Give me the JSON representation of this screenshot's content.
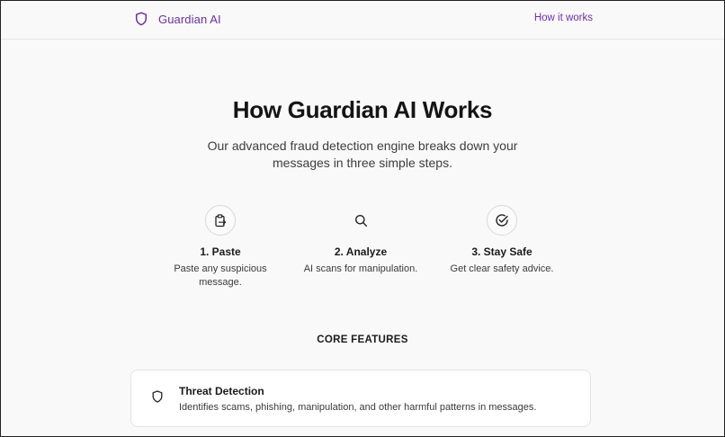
{
  "header": {
    "brand": "Guardian AI",
    "brand_icon": "shield-icon",
    "nav_link": "How it works",
    "accent_color": "#6b2fa6"
  },
  "hero": {
    "title": "How Guardian AI Works",
    "subtitle": "Our advanced fraud detection engine breaks down your messages in three simple steps."
  },
  "steps": [
    {
      "icon": "clipboard-icon",
      "title": "1. Paste",
      "description": "Paste any suspicious message."
    },
    {
      "icon": "search-icon",
      "title": "2. Analyze",
      "description": "AI scans for manipulation."
    },
    {
      "icon": "check-circle-icon",
      "title": "3. Stay Safe",
      "description": "Get clear safety advice."
    }
  ],
  "features": {
    "heading": "CORE FEATURES",
    "items": [
      {
        "icon": "shield-icon",
        "title": "Threat Detection",
        "description": "Identifies scams, phishing, manipulation, and other harmful patterns in messages."
      }
    ]
  }
}
